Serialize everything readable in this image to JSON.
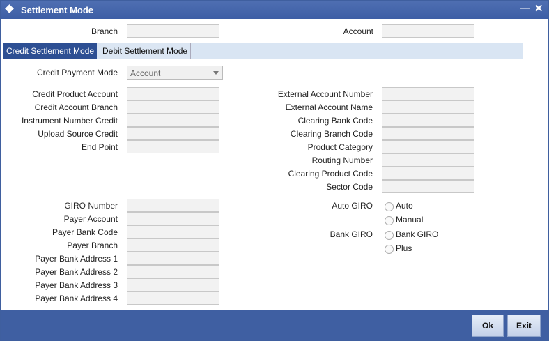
{
  "window": {
    "title": "Settlement Mode"
  },
  "header": {
    "branch_label": "Branch",
    "account_label": "Account",
    "branch_value": "",
    "account_value": ""
  },
  "tabs": [
    {
      "label": "Credit Settlement Mode",
      "active": true
    },
    {
      "label": "Debit Settlement Mode",
      "active": false
    }
  ],
  "credit_payment_mode": {
    "label": "Credit Payment Mode",
    "value": "Account"
  },
  "left_fields": [
    {
      "label": "Credit Product Account",
      "value": ""
    },
    {
      "label": "Credit Account Branch",
      "value": ""
    },
    {
      "label": "Instrument Number Credit",
      "value": ""
    },
    {
      "label": "Upload Source Credit",
      "value": ""
    },
    {
      "label": "End Point",
      "value": ""
    }
  ],
  "right_fields": [
    {
      "label": "External Account Number",
      "value": ""
    },
    {
      "label": "External Account Name",
      "value": ""
    },
    {
      "label": "Clearing Bank Code",
      "value": ""
    },
    {
      "label": "Clearing Branch Code",
      "value": ""
    },
    {
      "label": "Product Category",
      "value": ""
    },
    {
      "label": "Routing Number",
      "value": ""
    },
    {
      "label": "Clearing Product Code",
      "value": ""
    },
    {
      "label": "Sector Code",
      "value": ""
    }
  ],
  "giro_fields": [
    {
      "label": "GIRO Number",
      "value": ""
    },
    {
      "label": "Payer Account",
      "value": ""
    },
    {
      "label": "Payer Bank Code",
      "value": ""
    },
    {
      "label": "Payer Branch",
      "value": ""
    },
    {
      "label": "Payer Bank Address 1",
      "value": ""
    },
    {
      "label": "Payer Bank Address 2",
      "value": ""
    },
    {
      "label": "Payer Bank Address 3",
      "value": ""
    },
    {
      "label": "Payer Bank Address 4",
      "value": ""
    }
  ],
  "auto_giro": {
    "label": "Auto GIRO",
    "options": [
      "Auto",
      "Manual"
    ]
  },
  "bank_giro": {
    "label": "Bank GIRO",
    "options": [
      "Bank GIRO",
      "Plus"
    ]
  },
  "buttons": {
    "ok": "Ok",
    "exit": "Exit"
  },
  "icons": {
    "title": "diamond-icon",
    "minimize": "minimize-icon",
    "close": "close-icon"
  }
}
